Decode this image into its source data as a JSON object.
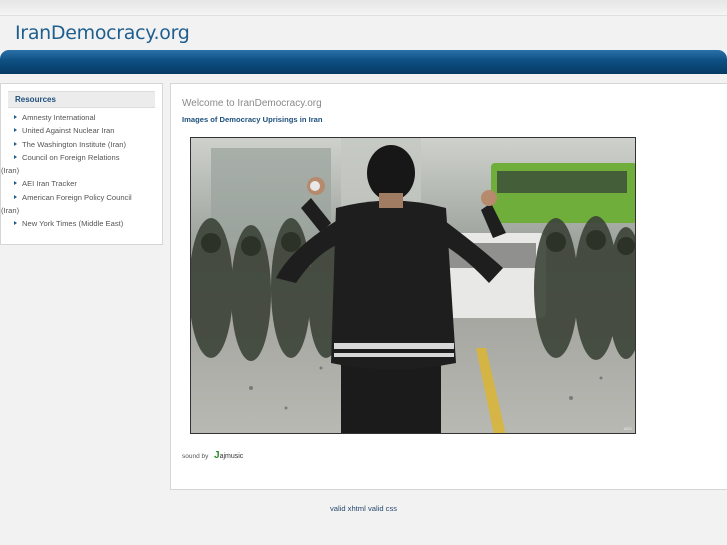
{
  "site": {
    "title": "IranDemocracy.org"
  },
  "sidebar": {
    "heading": "Resources",
    "links": [
      {
        "label": "Amnesty International"
      },
      {
        "label": "United Against Nuclear Iran"
      },
      {
        "label": "The Washington Institute (Iran)"
      },
      {
        "label": "Council on Foreign Relations",
        "cont": "(Iran)"
      },
      {
        "label": "AEI Iran Tracker"
      },
      {
        "label": "American Foreign Policy Council",
        "cont": "(Iran)"
      },
      {
        "label": "New York Times (Middle East)"
      }
    ]
  },
  "main": {
    "welcome": "Welcome to IranDemocracy.org",
    "subheading": "Images of Democracy Uprisings in Iran",
    "photo_credit": "AED",
    "sound_by": "sound by",
    "sound_logo_mark": "J",
    "sound_logo_text": "ajmusic"
  },
  "footer": {
    "xhtml": "valid xhtml",
    "css": "valid css"
  }
}
